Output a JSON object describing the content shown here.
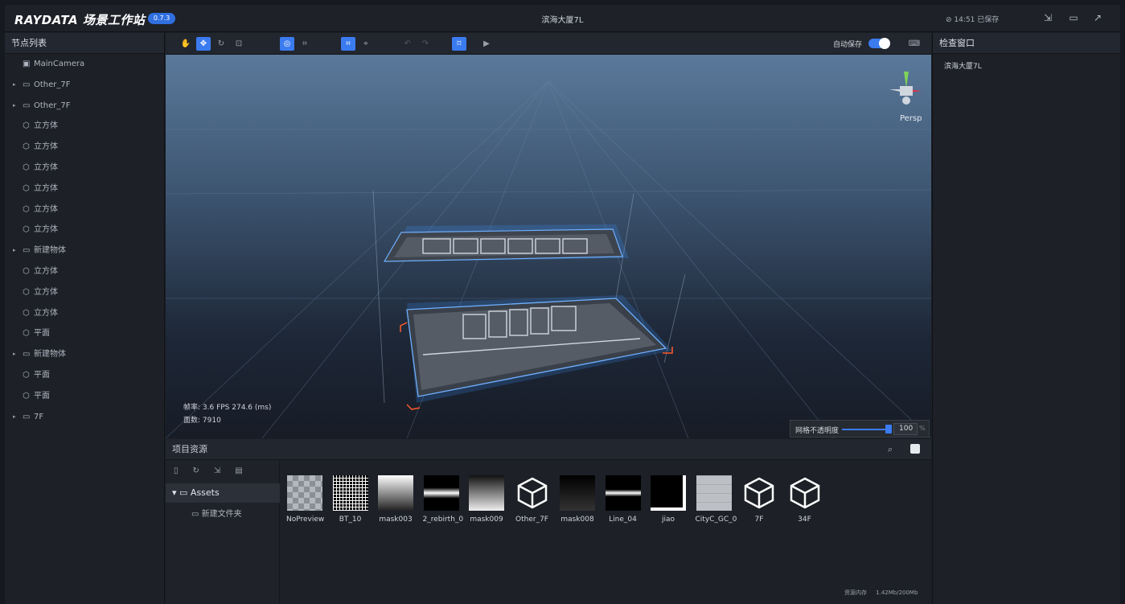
{
  "app": {
    "logo": "RAYDATA 场景工作站",
    "version": "0.7.3",
    "document_title": "滨海大厦7L",
    "save_status": "⊘ 14:51 已保存",
    "accent_color": "#3b7bf0"
  },
  "node_list": {
    "title": "节点列表",
    "items": [
      {
        "label": "MainCamera",
        "icon": "camera-icon",
        "expandable": false
      },
      {
        "label": "Other_7F",
        "icon": "folder-icon",
        "expandable": true
      },
      {
        "label": "Other_7F",
        "icon": "folder-icon",
        "expandable": true
      },
      {
        "label": "立方体",
        "icon": "cube-icon",
        "expandable": false
      },
      {
        "label": "立方体",
        "icon": "cube-icon",
        "expandable": false
      },
      {
        "label": "立方体",
        "icon": "cube-icon",
        "expandable": false
      },
      {
        "label": "立方体",
        "icon": "cube-icon",
        "expandable": false
      },
      {
        "label": "立方体",
        "icon": "cube-icon",
        "expandable": false
      },
      {
        "label": "立方体",
        "icon": "cube-icon",
        "expandable": false
      },
      {
        "label": "新建物体",
        "icon": "folder-icon",
        "expandable": true
      },
      {
        "label": "立方体",
        "icon": "cube-icon",
        "expandable": false
      },
      {
        "label": "立方体",
        "icon": "cube-icon",
        "expandable": false
      },
      {
        "label": "立方体",
        "icon": "cube-icon",
        "expandable": false
      },
      {
        "label": "平面",
        "icon": "cube-icon",
        "expandable": false
      },
      {
        "label": "新建物体",
        "icon": "folder-icon",
        "expandable": true
      },
      {
        "label": "平面",
        "icon": "cube-icon",
        "expandable": false
      },
      {
        "label": "平面",
        "icon": "cube-icon",
        "expandable": false
      },
      {
        "label": "7F",
        "icon": "folder-icon",
        "expandable": true
      }
    ]
  },
  "viewport": {
    "autosave_label": "自动保存",
    "autosave_on": true,
    "stats_fps": "帧率: 3.6 FPS 274.6 (ms)",
    "stats_faces": "面数: 7910",
    "view_mode": "Persp",
    "grid_opacity_label": "网格不透明度",
    "grid_opacity_value": "100",
    "grid_opacity_unit": "%"
  },
  "inspector": {
    "title": "检查窗口",
    "selected": "滨海大厦7L"
  },
  "assets": {
    "title": "项目资源",
    "root_folder": "Assets",
    "subfolder": "新建文件夹",
    "items": [
      {
        "name": "NoPreview",
        "kind": "checker"
      },
      {
        "name": "BT_10",
        "kind": "grid"
      },
      {
        "name": "mask003",
        "kind": "gradient-v"
      },
      {
        "name": "2_rebirth_0",
        "kind": "band"
      },
      {
        "name": "mask009",
        "kind": "gradient-v2"
      },
      {
        "name": "Other_7F",
        "kind": "model"
      },
      {
        "name": "mask008",
        "kind": "dark-gradient"
      },
      {
        "name": "Line_04",
        "kind": "line"
      },
      {
        "name": "jiao",
        "kind": "corner"
      },
      {
        "name": "CityC_GC_0",
        "kind": "tile"
      },
      {
        "name": "7F",
        "kind": "model"
      },
      {
        "name": "34F",
        "kind": "model"
      }
    ],
    "memory_label": "资源内存",
    "memory_value": "1.42Mb/200Mb"
  }
}
